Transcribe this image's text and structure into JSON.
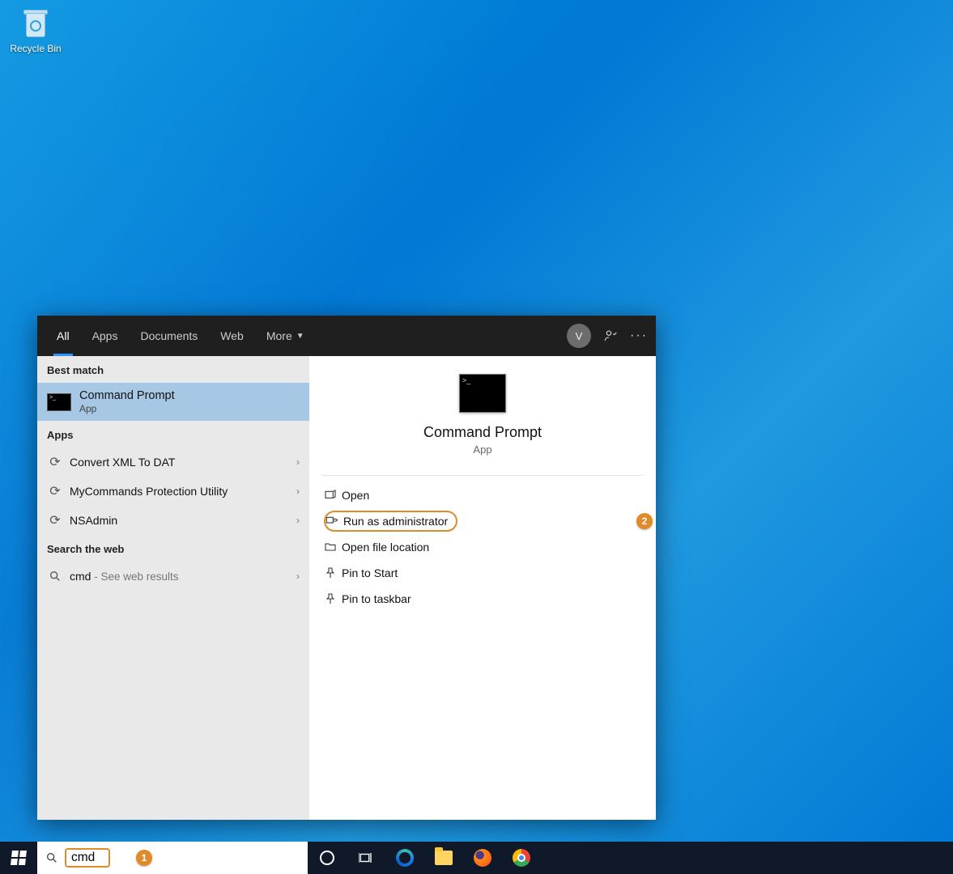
{
  "desktop": {
    "recycle_bin_label": "Recycle Bin"
  },
  "search_panel": {
    "tabs": {
      "all": "All",
      "apps": "Apps",
      "documents": "Documents",
      "web": "Web",
      "more": "More"
    },
    "avatar_initial": "V",
    "sections": {
      "best_match": "Best match",
      "apps": "Apps",
      "search_web": "Search the web"
    },
    "best_match": {
      "title": "Command Prompt",
      "subtitle": "App"
    },
    "app_results": [
      {
        "label": "Convert XML To DAT"
      },
      {
        "label": "MyCommands Protection Utility"
      },
      {
        "label": "NSAdmin"
      }
    ],
    "web_result": {
      "term": "cmd",
      "hint": " - See web results"
    },
    "preview": {
      "title": "Command Prompt",
      "subtitle": "App"
    },
    "actions": {
      "open": "Open",
      "run_admin": "Run as administrator",
      "open_location": "Open file location",
      "pin_start": "Pin to Start",
      "pin_taskbar": "Pin to taskbar"
    }
  },
  "callouts": {
    "step1": "1",
    "step2": "2"
  },
  "taskbar": {
    "search_value": "cmd"
  }
}
